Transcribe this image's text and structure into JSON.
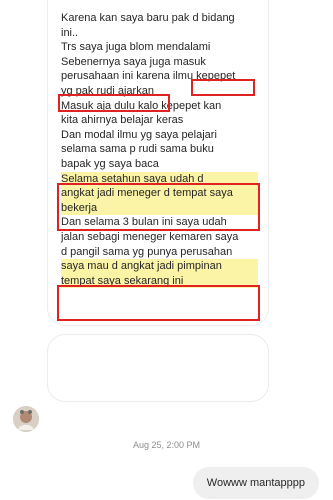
{
  "incoming_message": {
    "lines": [
      "Karena kan saya baru pak d bidang",
      "ini..",
      "Trs saya juga blom mendalami",
      "Sebenernya saya juga masuk",
      "perusahaan ini karena ilmu kepepet",
      "yg pak rudi ajarkan",
      "Masuk aja dulu kalo kepepet kan",
      "kita ahirnya belajar keras",
      "Dan modal ilmu yg saya pelajari",
      "selama sama p rudi sama buku",
      "bapak yg saya baca",
      "Selama  setahun saya udah  d",
      "angkat jadi meneger d tempat saya",
      "bekerja",
      "Dan selama 3 bulan ini saya udah",
      "jalan sebagi meneger kemaren saya",
      "d pangil sama yg punya perusahan",
      "saya mau d angkat jadi pimpinan",
      "tempat saya sekarang ini"
    ],
    "highlight_color": "#fbf3a6",
    "outline_color": "#e12222"
  },
  "timestamp": "Aug 25, 2:00 PM",
  "outgoing_message": {
    "text": "Wowww mantapppp"
  }
}
